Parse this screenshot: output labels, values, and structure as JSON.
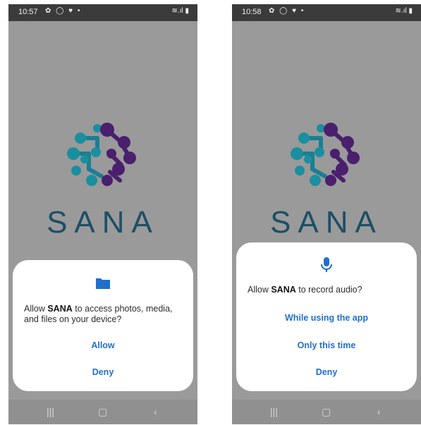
{
  "left_screen": {
    "status_time": "10:57",
    "status_icons": "✿ ◯ ♥ •",
    "status_right": "≋.ıl ▮",
    "brand": "SANA",
    "dialog": {
      "icon": "folder-icon",
      "message_prefix": "Allow ",
      "app_name": "SANA",
      "message_suffix": " to access photos, media, and files on your device?",
      "allow": "Allow",
      "deny": "Deny"
    }
  },
  "right_screen": {
    "status_time": "10:58",
    "status_icons": "✿ ◯ ♥ •",
    "status_right": "≋.ıl ▮",
    "brand": "SANA",
    "dialog": {
      "icon": "microphone-icon",
      "message_prefix": "Allow ",
      "app_name": "SANA",
      "message_suffix": " to record audio?",
      "while_using": "While using the app",
      "only_this_time": "Only this time",
      "deny": "Deny"
    }
  },
  "navbar": {
    "recents": "|||",
    "home": "▢",
    "back": "‹"
  },
  "colors": {
    "accent": "#1f6fcf",
    "brand_text": "#1d4f66",
    "logo_teal": "#1a8fa0",
    "logo_purple": "#4a1f6e"
  }
}
